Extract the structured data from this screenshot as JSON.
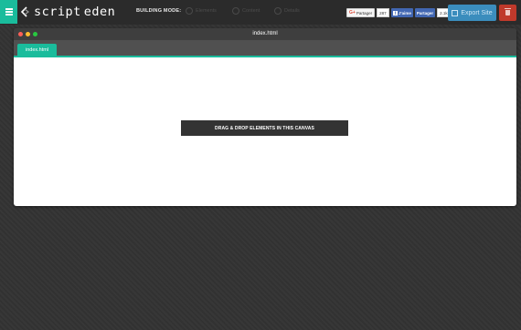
{
  "app": {
    "name_part1": "script",
    "name_part2": "eden",
    "menu_icon": "hamburger-icon",
    "logo_icon": "code-chevron-icon"
  },
  "toolbar": {
    "building_mode_label": "BUILDING MODE:",
    "modes": [
      "Elements",
      "Content",
      "Details"
    ],
    "social": {
      "google_label": "Partager",
      "google_count": "287",
      "facebook_like_label": "J'aime",
      "facebook_share_label": "Partager",
      "facebook_count": "2.1k"
    },
    "export_label": "Export Site",
    "export_icon": "external-link-icon",
    "delete_icon": "trash-icon"
  },
  "window": {
    "title": "index.html",
    "tabs": [
      {
        "label": "index.html",
        "active": true
      }
    ],
    "traffic_lights": [
      "#ff5f57",
      "#febc2e",
      "#28c840"
    ]
  },
  "canvas": {
    "placeholder": "DRAG & DROP ELEMENTS IN THIS CANVAS"
  },
  "colors": {
    "accent": "#1abc9c",
    "export": "#3b8dbd",
    "danger": "#c0392b"
  }
}
